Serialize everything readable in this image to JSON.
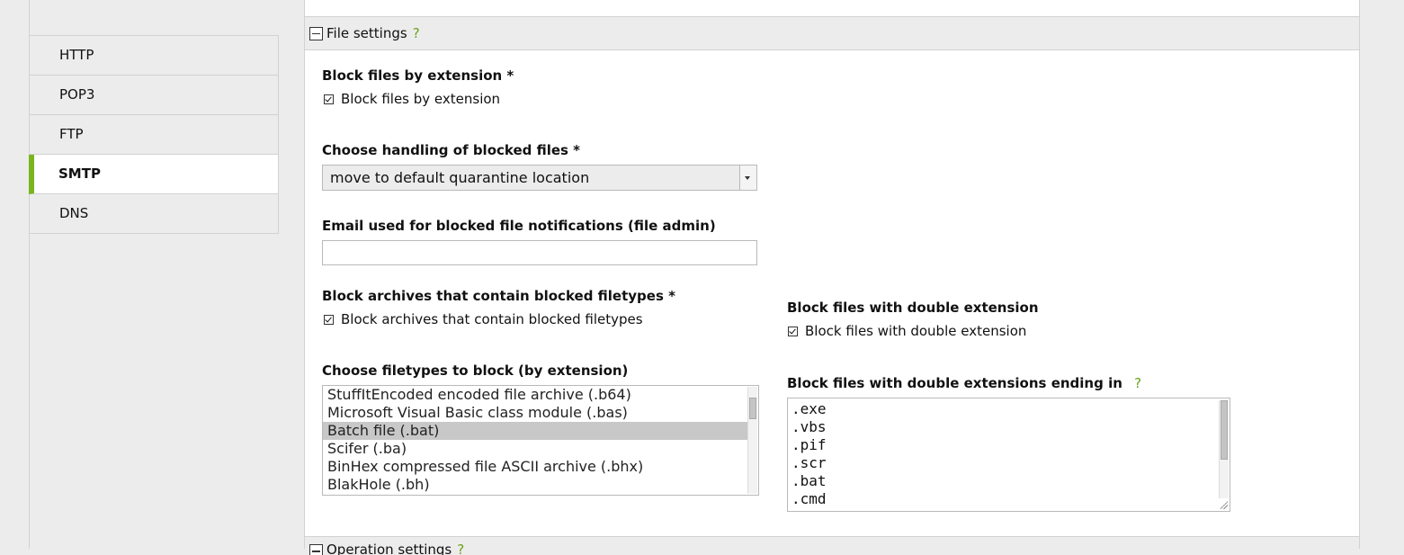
{
  "sidebar": {
    "items": [
      {
        "label": "HTTP",
        "active": false
      },
      {
        "label": "POP3",
        "active": false
      },
      {
        "label": "FTP",
        "active": false
      },
      {
        "label": "SMTP",
        "active": true
      },
      {
        "label": "DNS",
        "active": false
      }
    ]
  },
  "section": {
    "title": "File settings",
    "help": "?"
  },
  "fields": {
    "block_by_ext": {
      "label": "Block files by extension *",
      "checkbox_label": "Block files by extension",
      "checked": true
    },
    "handling": {
      "label": "Choose handling of blocked files *",
      "value": "move to default quarantine location"
    },
    "email": {
      "label": "Email used for blocked file notifications (file admin)",
      "value": ""
    },
    "block_archives": {
      "label": "Block archives that contain blocked filetypes *",
      "checkbox_label": "Block archives that contain blocked filetypes",
      "checked": true
    },
    "block_double": {
      "label": "Block files with double extension",
      "checkbox_label": "Block files with double extension",
      "checked": true
    },
    "filetypes": {
      "label": "Choose filetypes to block (by extension)",
      "options": [
        "StuffItEncoded encoded file archive (.b64)",
        "Microsoft Visual Basic class module (.bas)",
        "Batch file (.bat)",
        "Scifer (.ba)",
        "BinHex compressed file ASCII archive (.bhx)",
        "BlakHole (.bh)"
      ],
      "selected": "Batch file (.bat)"
    },
    "double_endings": {
      "label": "Block files with double extensions ending in",
      "help": "?",
      "lines": [
        ".exe",
        ".vbs",
        ".pif",
        ".scr",
        ".bat",
        ".cmd"
      ]
    }
  },
  "next_section": {
    "title": "Operation settings",
    "help": "?"
  }
}
